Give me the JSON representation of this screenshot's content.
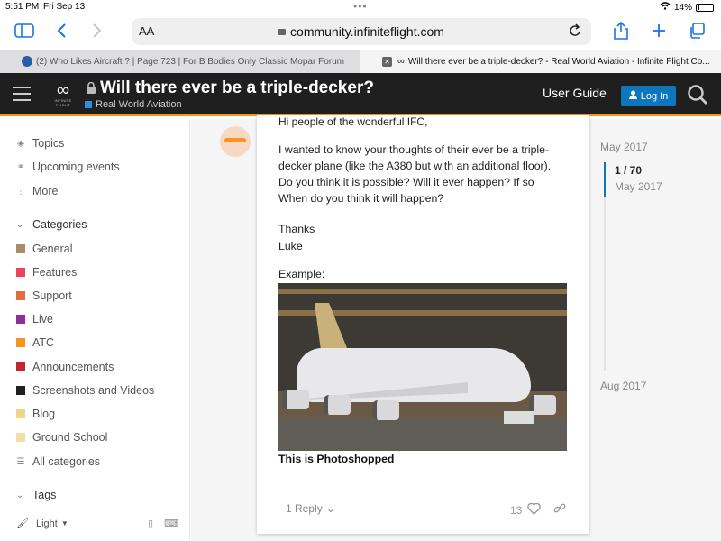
{
  "status_bar": {
    "time": "5:51 PM",
    "date": "Fri Sep 13",
    "battery": "14%",
    "battery_level": 0.14,
    "dots": "•••"
  },
  "browser": {
    "text_size_label": "AA",
    "url": "community.infiniteflight.com",
    "tabs": [
      {
        "title": "(2) Who Likes Aircraft ? | Page 723 | For B Bodies Only Classic Mopar Forum",
        "active": false
      },
      {
        "title": "Will there ever be a triple-decker? - Real World Aviation - Infinite Flight Co...",
        "active": true
      }
    ],
    "tab_close_glyph": "✕"
  },
  "header": {
    "brand": "INFINITE FLIGHT",
    "topic_title": "Will there ever be a triple-decker?",
    "category": "Real World Aviation",
    "category_color": "#2e8fd8",
    "user_guide": "User Guide",
    "login": "Log In",
    "accent": "#f7941d"
  },
  "sidebar": {
    "nav": [
      {
        "label": "Topics",
        "icon": "layers-icon"
      },
      {
        "label": "Upcoming events",
        "icon": "link-icon"
      },
      {
        "label": "More",
        "icon": "vertical-dots-icon"
      }
    ],
    "categories_heading": "Categories",
    "categories": [
      {
        "label": "General",
        "color": "#a98b6b"
      },
      {
        "label": "Features",
        "color": "#e8455e"
      },
      {
        "label": "Support",
        "color": "#e36b3f"
      },
      {
        "label": "Live",
        "color": "#8e2c9c"
      },
      {
        "label": "ATC",
        "color": "#f7941d"
      },
      {
        "label": "Announcements",
        "color": "#c1272d"
      },
      {
        "label": "Screenshots and Videos",
        "color": "#231f20"
      },
      {
        "label": "Blog",
        "color": "#f0d58a"
      },
      {
        "label": "Ground School",
        "color": "#f2dfa6"
      }
    ],
    "all_categories": "All categories",
    "tags_heading": "Tags",
    "theme": "Light"
  },
  "post": {
    "cut_line": "Hi people of the wonderful IFC,",
    "body_lines": [
      "I wanted to know your thoughts of their ever be a triple-",
      "decker plane (like the A380 but with an additional floor).",
      "Do you think it is possible? Will it ever happen? If so",
      "When do you think it will happen?"
    ],
    "thanks": "Thanks",
    "signature": "Luke",
    "example_label": "Example:",
    "image_caption": "This is Photoshopped",
    "replies": "1 Reply",
    "likes": "13"
  },
  "timeline": {
    "start": "May 2017",
    "position": "1 / 70",
    "position_date": "May 2017",
    "end": "Aug 2017"
  }
}
